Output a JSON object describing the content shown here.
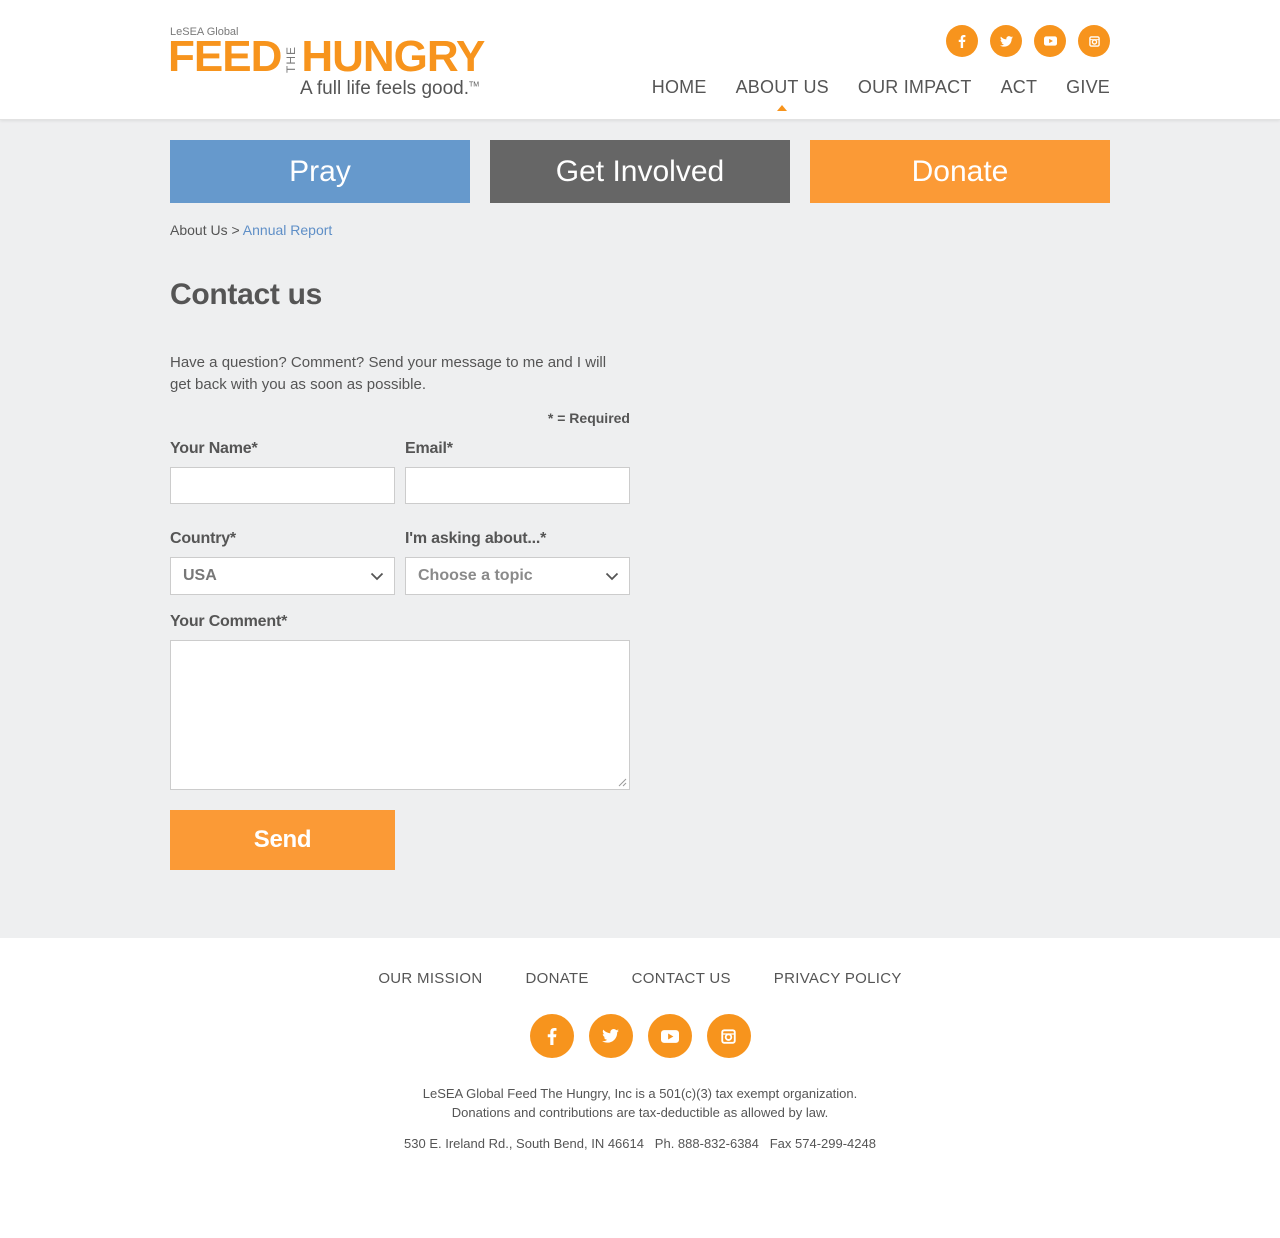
{
  "logo": {
    "small": "LeSEA Global",
    "feed": "FEED",
    "the": "THE",
    "hungry": "HUNGRY",
    "tagline": "A full life feels good.",
    "tm": "TM"
  },
  "social": [
    "facebook-icon",
    "twitter-icon",
    "youtube-icon",
    "instagram-icon"
  ],
  "nav": {
    "home": "HOME",
    "about": "ABOUT US",
    "impact": "OUR IMPACT",
    "act": "ACT",
    "give": "GIVE"
  },
  "cta": {
    "pray": "Pray",
    "involved": "Get Involved",
    "donate": "Donate"
  },
  "breadcrumb": {
    "parent": "About Us",
    "separator": ">",
    "current": "Annual Report"
  },
  "page": {
    "title": "Contact us",
    "intro": "Have a question? Comment? Send your message to me and I will get back with you as soon as possible.",
    "required_note": "* = Required"
  },
  "form": {
    "name_label": "Your Name*",
    "name_value": "",
    "email_label": "Email*",
    "email_value": "",
    "country_label": "Country*",
    "country_value": "USA",
    "topic_label": "I'm asking about...*",
    "topic_value": "Choose a topic",
    "comment_label": "Your Comment*",
    "comment_value": "",
    "send_label": "Send"
  },
  "footer": {
    "nav": {
      "mission": "OUR MISSION",
      "donate": "DONATE",
      "contact": "CONTACT US",
      "privacy": "PRIVACY POLICY"
    },
    "legal_line1": "LeSEA Global Feed The Hungry, Inc is a 501(c)(3) tax exempt organization.",
    "legal_line2": "Donations and contributions are tax-deductible as allowed by law.",
    "address": "530 E. Ireland Rd., South Bend, IN 46614   Ph. 888-832-6384   Fax 574-299-4248"
  },
  "colors": {
    "accent": "#f7941d",
    "pray": "#6699cc",
    "involved": "#666666",
    "donate": "#fb9a36",
    "link": "#5f8fc7"
  }
}
